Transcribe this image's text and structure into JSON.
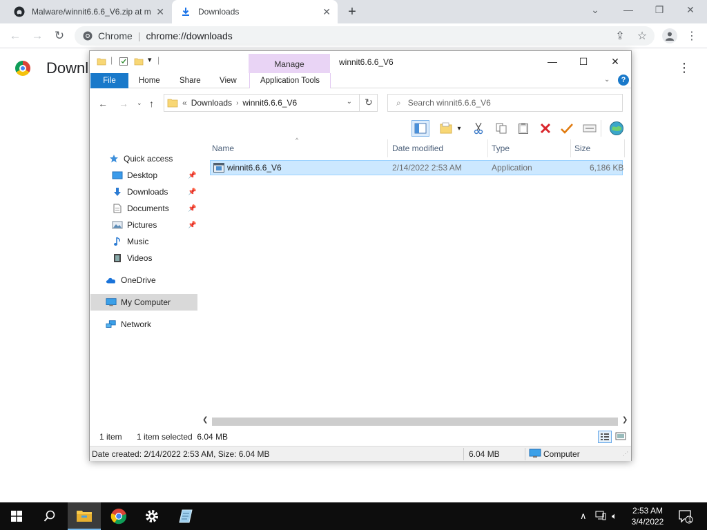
{
  "chrome": {
    "tabs": [
      {
        "label": "Malware/winnit6.6.6_V6.zip at m"
      },
      {
        "label": "Downloads"
      }
    ],
    "omnibox": {
      "site_label": "Chrome",
      "url": "chrome://downloads"
    },
    "page": {
      "title": "Downl"
    }
  },
  "explorer": {
    "title": "winnit6.6.6_V6",
    "contextual_tab_group": "Manage",
    "ribbon_tabs": [
      "File",
      "Home",
      "Share",
      "View",
      "Application Tools"
    ],
    "address": {
      "overflow": "«",
      "crumbs": [
        "Downloads",
        "winnit6.6.6_V6"
      ]
    },
    "search_placeholder": "Search winnit6.6.6_V6",
    "nav_pane": [
      {
        "label": "Quick access",
        "icon": "star-icon"
      },
      {
        "label": "Desktop",
        "icon": "desktop-icon",
        "pinned": true
      },
      {
        "label": "Downloads",
        "icon": "download-arrow-icon",
        "pinned": true
      },
      {
        "label": "Documents",
        "icon": "document-icon",
        "pinned": true
      },
      {
        "label": "Pictures",
        "icon": "picture-icon",
        "pinned": true
      },
      {
        "label": "Music",
        "icon": "music-note-icon"
      },
      {
        "label": "Videos",
        "icon": "film-icon"
      },
      {
        "label": "OneDrive",
        "icon": "cloud-icon"
      },
      {
        "label": "My Computer",
        "icon": "computer-icon",
        "selected": true
      },
      {
        "label": "Network",
        "icon": "network-icon"
      }
    ],
    "columns": [
      "Name",
      "Date modified",
      "Type",
      "Size"
    ],
    "files": [
      {
        "name": "winnit6.6.6_V6",
        "date_modified": "2/14/2022 2:53 AM",
        "type": "Application",
        "size": "6,186 KB"
      }
    ],
    "status": {
      "count": "1 item",
      "selection": "1 item selected  6.04 MB"
    },
    "details_bar": {
      "info": "Date created: 2/14/2022 2:53 AM, Size: 6.04 MB",
      "size": "6.04 MB",
      "location": "Computer"
    }
  },
  "taskbar": {
    "time": "2:53 AM",
    "date": "3/4/2022",
    "notifications": "1"
  },
  "colors": {
    "ribbon_file": "#1979ca",
    "manage_tab": "#e9d4f5",
    "selected_row": "#cce8ff",
    "taskbar": "#0d0d0d"
  }
}
